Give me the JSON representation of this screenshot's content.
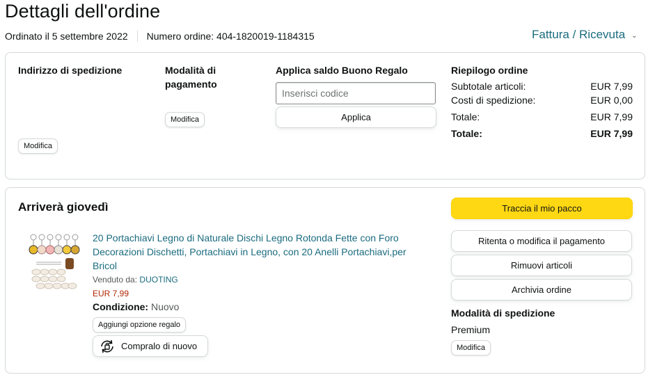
{
  "header": {
    "title": "Dettagli dell'ordine",
    "order_date": "Ordinato il 5 settembre 2022",
    "order_number": "Numero ordine: 404-1820019-1184315",
    "invoice_label": "Fattura / Ricevuta",
    "invoice_icon": "chevron-down-icon"
  },
  "shipping_address": {
    "title": "Indirizzo di spedizione",
    "edit_label": "Modifica"
  },
  "payment_method": {
    "title": "Modalità di pagamento",
    "edit_label": "Modifica"
  },
  "gift_card": {
    "title": "Applica saldo Buono Regalo",
    "placeholder": "Inserisci codice",
    "apply_label": "Applica"
  },
  "order_summary": {
    "title": "Riepilogo ordine",
    "rows": [
      {
        "label": "Subtotale articoli:",
        "value": "EUR 7,99"
      },
      {
        "label": "Costi di spedizione:",
        "value": "EUR 0,00"
      },
      {
        "label": "Totale:",
        "value": "EUR 7,99"
      },
      {
        "label": "Totale:",
        "value": "EUR 7,99"
      }
    ]
  },
  "shipment": {
    "arrival": "Arriverà giovedì",
    "product": {
      "title": "20 Portachiavi Legno di Naturale Dischi Legno Rotonda Fette con Foro Decorazioni Dischetti, Portachiavi in Legno, con 20 Anelli Portachiavi,per Bricol",
      "sold_by_prefix": "Venduto da:",
      "seller": "DUOTING",
      "price": "EUR 7,99",
      "condition_label": "Condizione:",
      "condition_value": "Nuovo",
      "gift_option_label": "Aggiungi opzione regalo",
      "buy_again_label": "Compralo di nuovo",
      "buy_again_icon": "buy-again-icon"
    },
    "actions": {
      "track": "Traccia il mio pacco",
      "retry_payment": "Ritenta o modifica il pagamento",
      "remove_items": "Rimuovi articoli",
      "archive": "Archivia ordine"
    },
    "shipping_method": {
      "title": "Modalità di spedizione",
      "value": "Premium",
      "edit_label": "Modifica"
    }
  },
  "colors": {
    "link": "#1a6b7e",
    "price": "#b12704",
    "track_button": "#ffd814",
    "border": "#d5d9d9"
  }
}
